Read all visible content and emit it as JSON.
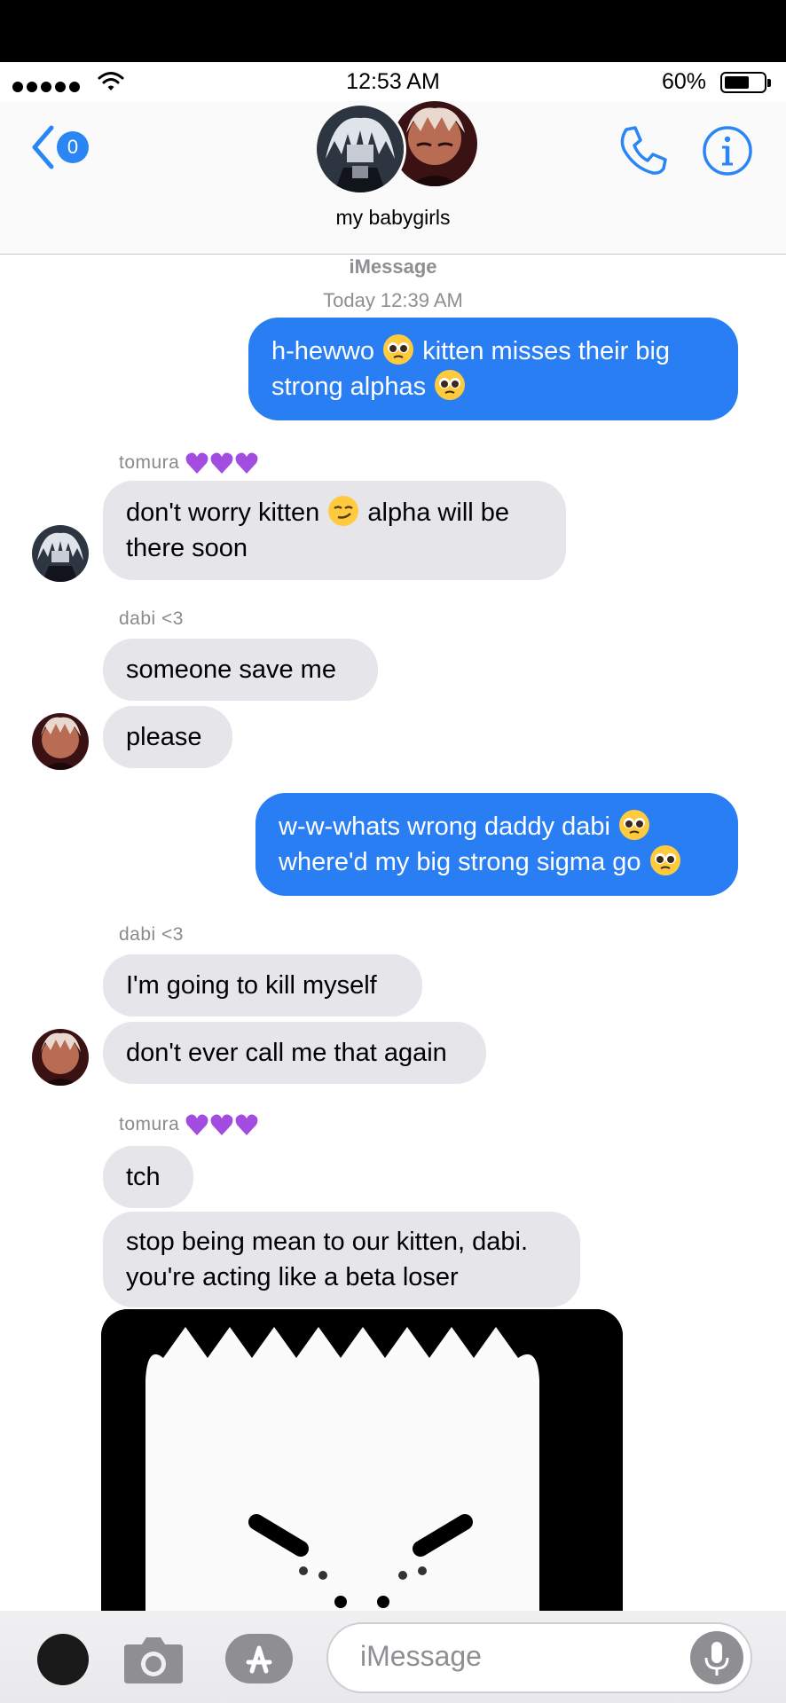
{
  "status_bar": {
    "time": "12:53 AM",
    "battery_pct": "60%",
    "battery_level": 0.6
  },
  "header": {
    "back_count": "0",
    "group_name": "my babygirls"
  },
  "thread": {
    "service": "iMessage",
    "timestamp": "Today 12:39 AM",
    "m1": {
      "line1": "h-hewwo",
      "line1b": "kitten misses their big",
      "line2": "strong alphas"
    },
    "tomura_name": "tomura",
    "m2": {
      "line1a": "don't worry kitten",
      "line1b": "alpha will be",
      "line2": "there soon"
    },
    "dabi_name": "dabi <3",
    "m3": "someone save me",
    "m4": "please",
    "m5": {
      "line1": "w-w-whats wrong daddy dabi",
      "line2": "where'd my big strong sigma go"
    },
    "m6": "I'm going to kill myself",
    "m7": "don't ever call me that again",
    "m8": "tch",
    "m9": {
      "line1": "stop being mean to our kitten, dabi.",
      "line2": "you're acting like a beta loser"
    }
  },
  "composer": {
    "placeholder": "iMessage"
  },
  "colors": {
    "accent": "#2a86f4",
    "outgoing": "#2a7ef3",
    "incoming": "#e5e5ea",
    "heart": "#a24de0"
  },
  "icons": [
    "wifi-icon",
    "back-chevron-icon",
    "phone-icon",
    "info-icon",
    "camera-icon",
    "app-store-icon",
    "microphone-icon",
    "pleading-face-emoji",
    "smirk-emoji",
    "purple-heart-emoji"
  ]
}
